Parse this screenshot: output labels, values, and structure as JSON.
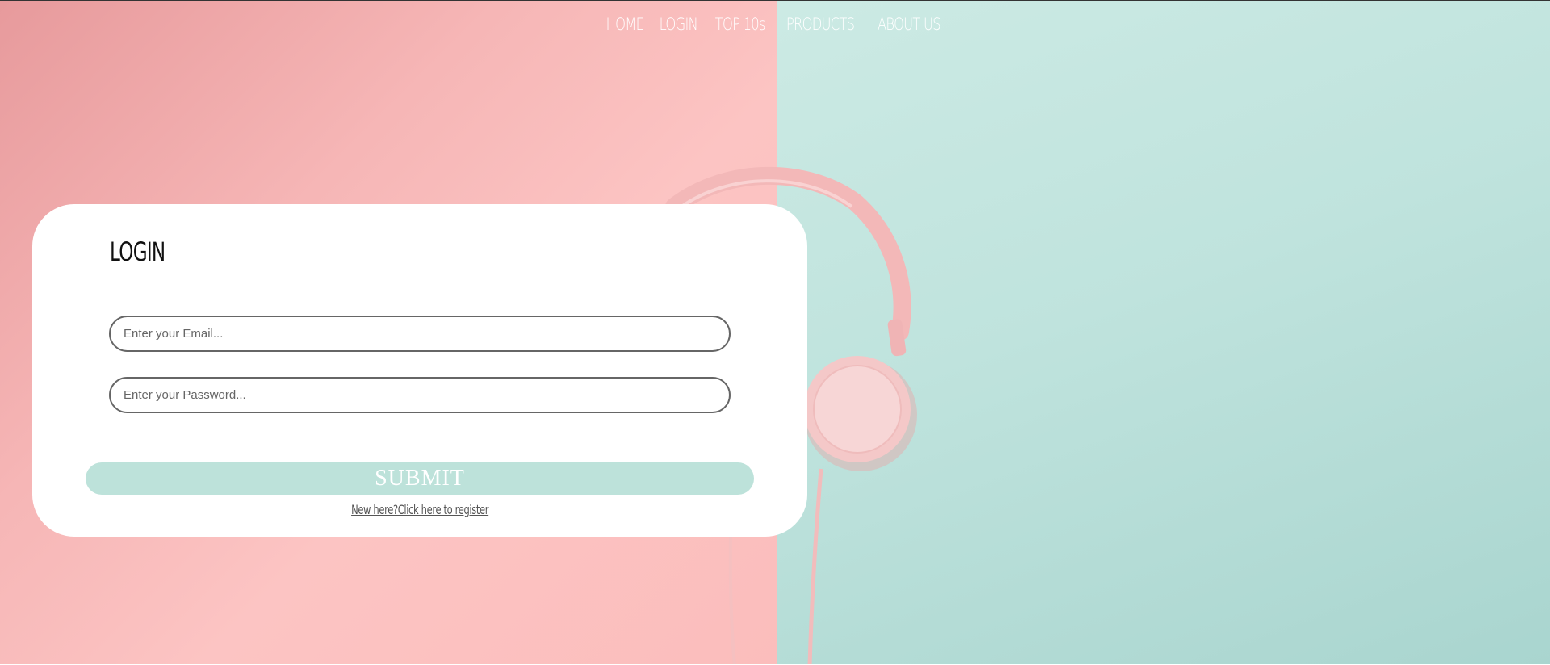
{
  "nav": {
    "items": [
      {
        "label": "HOME"
      },
      {
        "label": "LOGIN"
      },
      {
        "label": "TOP 10s"
      },
      {
        "label": "PRODUCTS"
      },
      {
        "label": "ABOUT US"
      }
    ]
  },
  "login": {
    "title": "LOGIN",
    "email_placeholder": "Enter your Email...",
    "email_value": "",
    "password_placeholder": "Enter your Password...",
    "password_value": "",
    "submit_label": "SUBMIT",
    "register_link": "New here?Click here to register"
  },
  "colors": {
    "pink_background": "#fcc4c3",
    "mint_background": "#bfe3dd",
    "submit_button": "#bde2da",
    "headphones": "#f6c3c3"
  },
  "icons": {
    "background_image": "headphones"
  }
}
